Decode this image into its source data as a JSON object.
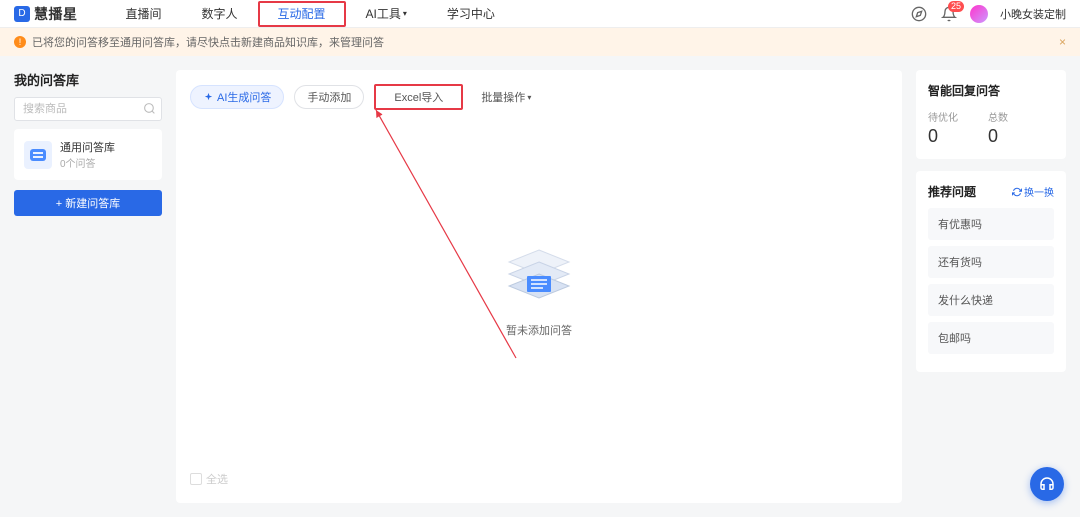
{
  "brand": {
    "logo_letter": "D",
    "name": "慧播星"
  },
  "nav": {
    "items": [
      {
        "label": "直播间"
      },
      {
        "label": "数字人"
      },
      {
        "label": "互动配置",
        "active": true
      },
      {
        "label": "AI工具",
        "dropdown": true
      },
      {
        "label": "学习中心"
      }
    ]
  },
  "nav_right": {
    "bell_badge": "25",
    "username": "小晚女装定制"
  },
  "notice": {
    "text": "已将您的问答移至通用问答库，请尽快点击新建商品知识库，来管理问答",
    "close": "×"
  },
  "left": {
    "title": "我的问答库",
    "search_placeholder": "搜索商品",
    "lib": {
      "name": "通用问答库",
      "count": "0个问答"
    },
    "new_btn": "+ 新建问答库"
  },
  "center": {
    "actions": {
      "ai_gen": "AI生成问答",
      "manual": "手动添加",
      "excel": "Excel导入",
      "batch": "批量操作"
    },
    "empty_text": "暂未添加问答",
    "footer_select_all": "全选"
  },
  "right": {
    "stats_title": "智能回复问答",
    "stat1_label": "待优化",
    "stat1_val": "0",
    "stat2_label": "总数",
    "stat2_val": "0",
    "suggest_title": "推荐问题",
    "refresh": "换一换",
    "suggestions": [
      "有优惠吗",
      "还有货吗",
      "发什么快递",
      "包邮吗"
    ]
  }
}
